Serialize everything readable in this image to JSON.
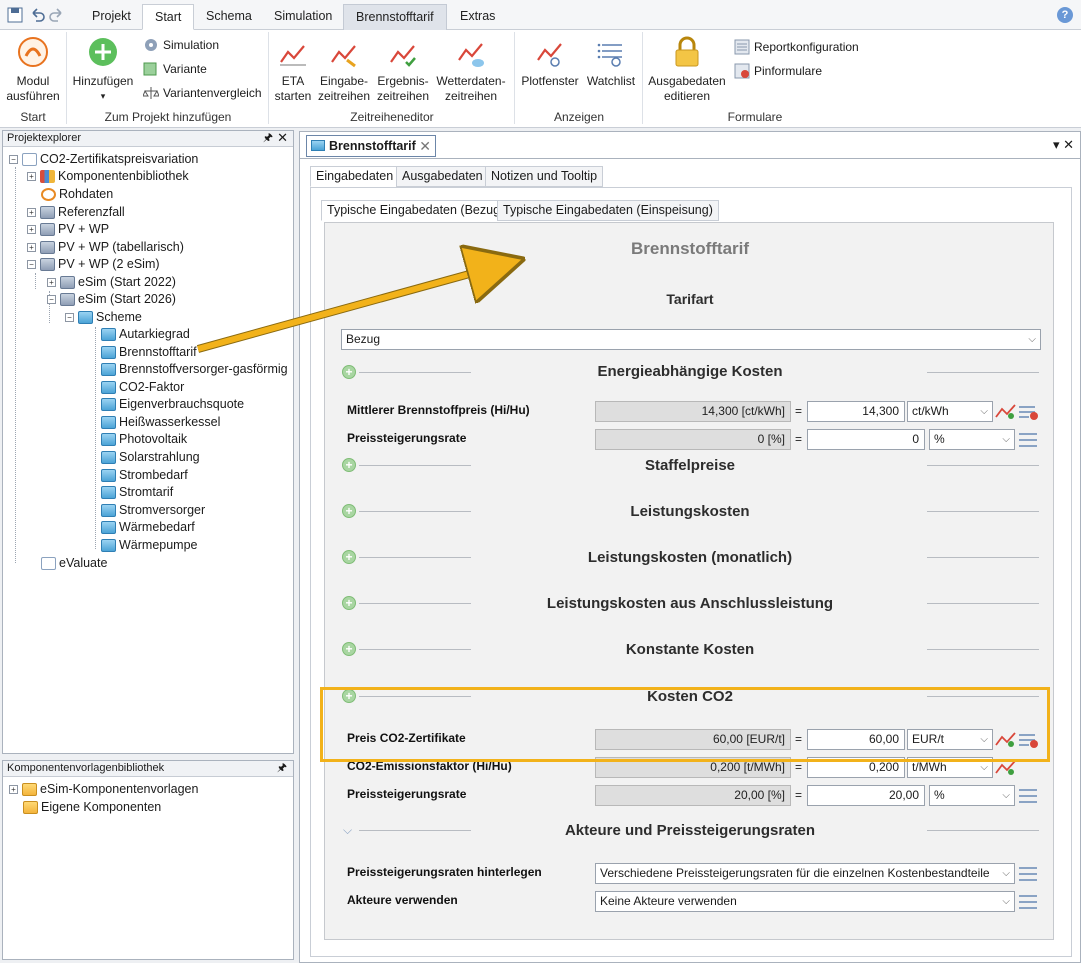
{
  "ribbon_tabs": [
    "Projekt",
    "Start",
    "Schema",
    "Simulation",
    "Brennstofftarif",
    "Extras"
  ],
  "ribbon": {
    "modul": "Modul ausführen",
    "hinzufuegen": "Hinzufügen",
    "simulation": "Simulation",
    "variante": "Variante",
    "variantenvergleich": "Variantenvergleich",
    "eta": "ETA starten",
    "eingabe": "Eingabe- zeitreihen",
    "ergebnis": "Ergebnis- zeitreihen",
    "wetter": "Wetterdaten- zeitreihen",
    "plotfenster": "Plotfenster",
    "watchlist": "Watchlist",
    "ausgabedaten": "Ausgabedaten editieren",
    "reportkonfig": "Reportkonfiguration",
    "pinformulare": "Pinformulare",
    "groups": [
      "Start",
      "Zum Projekt hinzufügen",
      "Zeitreiheneditor",
      "Anzeigen",
      "Formulare"
    ]
  },
  "projektexplorer": {
    "title": "Projektexplorer",
    "items": [
      "CO2-Zertifikatspreisvariation",
      "Komponentenbibliothek",
      "Rohdaten",
      "Referenzfall",
      "PV + WP",
      "PV + WP (tabellarisch)",
      "PV + WP (2 eSim)",
      "eSim (Start 2022)",
      "eSim (Start 2026)",
      "Scheme",
      "Autarkiegrad",
      "Brennstofftarif",
      "Brennstoffversorger-gasförmig",
      "CO2-Faktor",
      "Eigenverbrauchsquote",
      "Heißwasserkessel",
      "Photovoltaik",
      "Solarstrahlung",
      "Strombedarf",
      "Stromtarif",
      "Stromversorger",
      "Wärmebedarf",
      "Wärmepumpe",
      "eValuate"
    ]
  },
  "komponentenbib": {
    "title": "Komponentenvorlagenbibliothek",
    "items": [
      "eSim-Komponentenvorlagen",
      "Eigene Komponenten"
    ]
  },
  "doc": {
    "tab": "Brennstofftarif",
    "inner_tabs": [
      "Eingabedaten",
      "Ausgabedaten",
      "Notizen und Tooltip"
    ],
    "sub_tabs": [
      "Typische Eingabedaten (Bezug)",
      "Typische Eingabedaten (Einspeisung)"
    ],
    "title": "Brennstofftarif",
    "tarifart": "Tarifart",
    "tarifart_value": "Bezug",
    "sections": {
      "energie": "Energieabhängige Kosten",
      "staffel": "Staffelpreise",
      "leistung": "Leistungskosten",
      "leistung_monat": "Leistungskosten (monatlich)",
      "leistung_anschluss": "Leistungskosten aus Anschlussleistung",
      "konstant": "Konstante Kosten",
      "co2": "Kosten CO2",
      "akteure": "Akteure und Preissteigerungsraten"
    },
    "fields": {
      "brennstoffpreis": {
        "label": "Mittlerer Brennstoffpreis (Hi/Hu)",
        "ro": "14,300 [ct/kWh]",
        "value": "14,300",
        "unit": "ct/kWh"
      },
      "steigerung1": {
        "label": "Preissteigerungsrate",
        "ro": "0 [%]",
        "value": "0",
        "unit": "%"
      },
      "co2preis": {
        "label": "Preis CO2-Zertifikate",
        "ro": "60,00 [EUR/t]",
        "value": "60,00",
        "unit": "EUR/t"
      },
      "co2faktor": {
        "label": "CO2-Emissionsfaktor (Hi/Hu)",
        "ro": "0,200 [t/MWh]",
        "value": "0,200",
        "unit": "t/MWh"
      },
      "steigerung2": {
        "label": "Preissteigerungsrate",
        "ro": "20,00 [%]",
        "value": "20,00",
        "unit": "%"
      },
      "hinterlegen": {
        "label": "Preissteigerungsraten hinterlegen",
        "value": "Verschiedene Preissteigerungsraten für die einzelnen Kostenbestandteile"
      },
      "akteure": {
        "label": "Akteure verwenden",
        "value": "Keine Akteure verwenden"
      }
    }
  },
  "colors": {
    "highlight": "#f2b21a",
    "accent_green": "#a9d6a2",
    "ribbon_icon_red": "#d9473a"
  }
}
